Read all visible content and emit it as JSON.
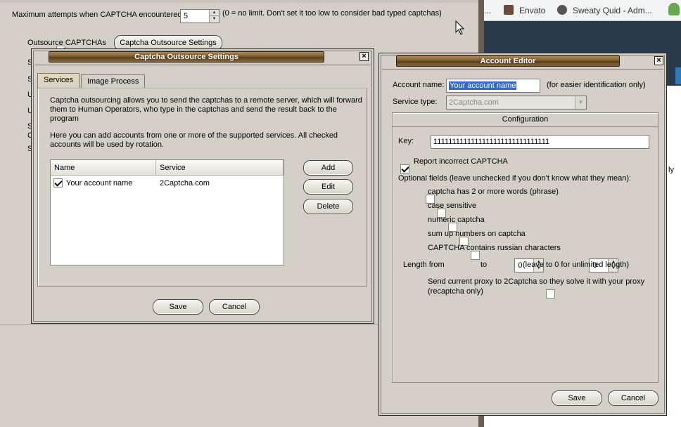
{
  "browser": {
    "bookmarks": [
      {
        "label": "...",
        "color": ""
      },
      {
        "label": "Envato",
        "color": "#6a4a3a"
      },
      {
        "label": "Sweaty Quid - Adm...",
        "color": "#555555"
      }
    ]
  },
  "bg_app": {
    "max_attempts_label": "Maximum attempts when CAPTCHA encountered:",
    "max_attempts_value": "5",
    "max_attempts_hint": "(0 = no limit. Don't set it too low to consider bad typed captchas)",
    "outsource_label": "Outsource CAPTCHAs",
    "outsource_settings_button": "Captcha Outsource Settings",
    "partial_labels": [
      "S",
      "S",
      "U",
      "U",
      "S",
      "C",
      "S"
    ],
    "right_partial": "ly"
  },
  "outsource_dialog": {
    "title": "Captcha Outsource Settings",
    "tabs": [
      "Services",
      "Image Process"
    ],
    "description": "Captcha outsourcing allows you to send the captchas to a remote server, which will forward them to Human Operators, who type in the captchas and send the result back to the program",
    "accounts_note": "Here you can add accounts from one or more of the supported services. All checked accounts will be used by rotation.",
    "columns": [
      "Name",
      "Service"
    ],
    "rows": [
      {
        "name": "Your account name",
        "service": "2Captcha.com",
        "checked": true
      }
    ],
    "buttons": {
      "add": "Add",
      "edit": "Edit",
      "delete": "Delete",
      "save": "Save",
      "cancel": "Cancel"
    }
  },
  "account_editor": {
    "title": "Account Editor",
    "account_name_label": "Account name:",
    "account_name_value": "Your account name",
    "account_name_hint": "(for easier identification only)",
    "service_type_label": "Service type:",
    "service_type_value": "2Captcha.com",
    "configuration_label": "Configuration",
    "key_label": "Key:",
    "key_value": "1111111111111111111111111111111",
    "report_incorrect_label": "Report incorrect CAPTCHA",
    "optional_fields_label": "Optional fields (leave unchecked if you don't know what they mean):",
    "optional_fields": [
      "captcha has 2 or more words (phrase)",
      "case sensitive",
      "numeric captcha",
      "sum up numbers on captcha",
      "CAPTCHA contains russian characters"
    ],
    "length_from_label": "Length from",
    "length_from_value": "0",
    "length_to_label": "to",
    "length_to_value": "0",
    "length_hint": "(leave to 0 for unlimited length)",
    "proxy_label_line1": "Send current proxy to 2Captcha so they solve it with your proxy",
    "proxy_label_line2": "(recaptcha only)",
    "buttons": {
      "save": "Save",
      "cancel": "Cancel"
    }
  }
}
